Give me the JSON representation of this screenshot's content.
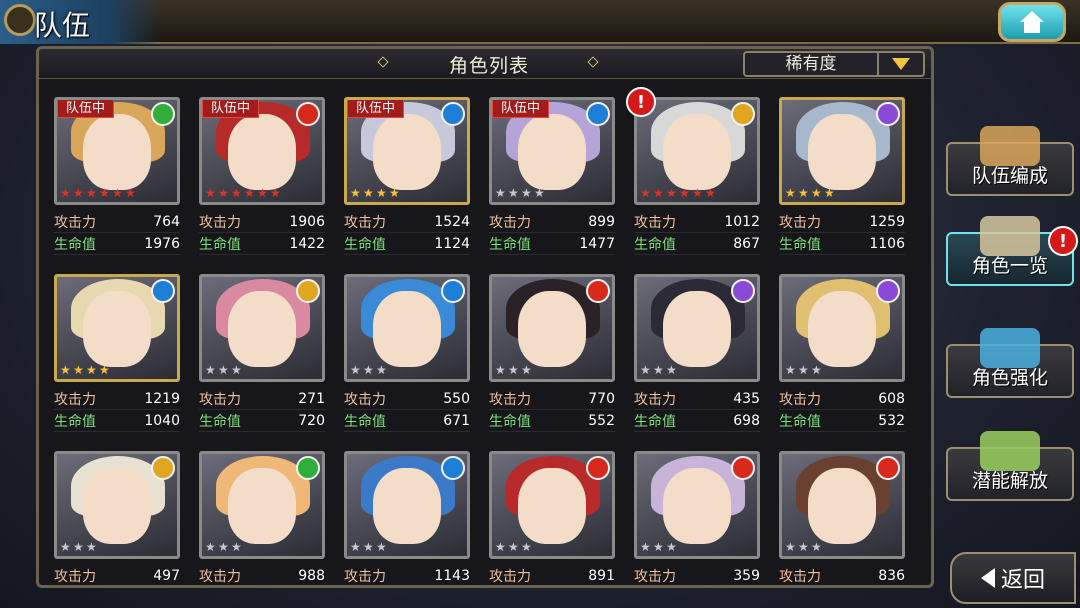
{
  "header": {
    "title": "队伍"
  },
  "panel": {
    "title": "角色列表",
    "sort_label": "稀有度"
  },
  "stat_labels": {
    "atk": "攻击力",
    "hp": "生命值"
  },
  "cards": [
    {
      "badge": "队伍中",
      "element": "wind",
      "stars": 6,
      "star_color": "red",
      "atk": "764",
      "hp": "1976",
      "hair": "#d9a65a",
      "alert": false
    },
    {
      "badge": "队伍中",
      "element": "fire",
      "stars": 6,
      "star_color": "red",
      "atk": "1906",
      "hp": "1422",
      "hair": "#b62a2a",
      "alert": false
    },
    {
      "badge": "队伍中",
      "element": "water",
      "stars": 4,
      "star_color": "gold",
      "atk": "1524",
      "hp": "1124",
      "hair": "#c8c8dc",
      "alert": false
    },
    {
      "badge": "队伍中",
      "element": "water",
      "stars": 4,
      "star_color": "silver",
      "atk": "899",
      "hp": "1477",
      "hair": "#b4a4d8",
      "alert": false
    },
    {
      "badge": "",
      "element": "light",
      "stars": 6,
      "star_color": "red",
      "atk": "1012",
      "hp": "867",
      "hair": "#d8d8d8",
      "alert": true
    },
    {
      "badge": "",
      "element": "dark",
      "stars": 4,
      "star_color": "gold",
      "atk": "1259",
      "hp": "1106",
      "hair": "#a8b8cc",
      "alert": false
    },
    {
      "badge": "",
      "element": "water",
      "stars": 4,
      "star_color": "gold",
      "atk": "1219",
      "hp": "1040",
      "hair": "#e8d8b0",
      "alert": false
    },
    {
      "badge": "",
      "element": "light",
      "stars": 3,
      "star_color": "silver",
      "atk": "271",
      "hp": "720",
      "hair": "#d98aa0",
      "alert": false
    },
    {
      "badge": "",
      "element": "water",
      "stars": 3,
      "star_color": "silver",
      "atk": "550",
      "hp": "671",
      "hair": "#3a8ad8",
      "alert": false
    },
    {
      "badge": "",
      "element": "fire",
      "stars": 3,
      "star_color": "silver",
      "atk": "770",
      "hp": "552",
      "hair": "#2a2226",
      "alert": false
    },
    {
      "badge": "",
      "element": "dark",
      "stars": 3,
      "star_color": "silver",
      "atk": "435",
      "hp": "698",
      "hair": "#2c2a36",
      "alert": false
    },
    {
      "badge": "",
      "element": "dark",
      "stars": 3,
      "star_color": "silver",
      "atk": "608",
      "hp": "532",
      "hair": "#e0c070",
      "alert": false
    },
    {
      "badge": "",
      "element": "light",
      "stars": 3,
      "star_color": "silver",
      "atk": "497",
      "hp": "",
      "hair": "#e8e0d0",
      "alert": false
    },
    {
      "badge": "",
      "element": "wind",
      "stars": 3,
      "star_color": "silver",
      "atk": "988",
      "hp": "",
      "hair": "#f0b878",
      "alert": false
    },
    {
      "badge": "",
      "element": "water",
      "stars": 3,
      "star_color": "silver",
      "atk": "1143",
      "hp": "",
      "hair": "#3a7ac8",
      "alert": false
    },
    {
      "badge": "",
      "element": "fire",
      "stars": 3,
      "star_color": "silver",
      "atk": "891",
      "hp": "",
      "hair": "#b82a2a",
      "alert": false
    },
    {
      "badge": "",
      "element": "fire",
      "stars": 3,
      "star_color": "silver",
      "atk": "359",
      "hp": "",
      "hair": "#c8b4d8",
      "alert": false
    },
    {
      "badge": "",
      "element": "fire",
      "stars": 3,
      "star_color": "silver",
      "atk": "836",
      "hp": "",
      "hair": "#6a4030",
      "alert": false
    }
  ],
  "side_menu": [
    {
      "label": "队伍编成",
      "active": false,
      "alert": false
    },
    {
      "label": "角色一览",
      "active": true,
      "alert": true
    },
    {
      "label": "角色强化",
      "active": false,
      "alert": false
    },
    {
      "label": "潜能解放",
      "active": false,
      "alert": false
    }
  ],
  "back_label": "返回",
  "alert_symbol": "!"
}
